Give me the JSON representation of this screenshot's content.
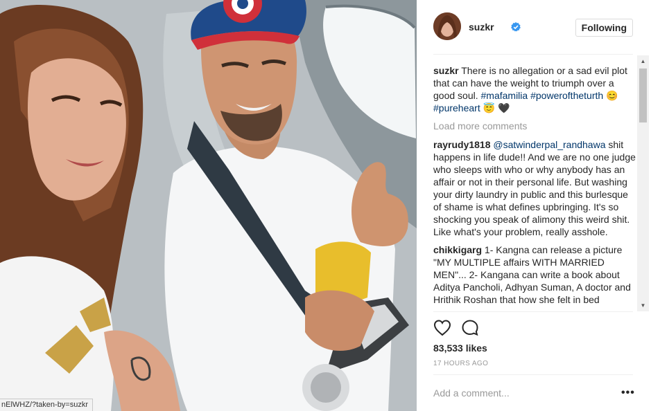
{
  "post": {
    "username": "suzkr",
    "follow_label": "Following",
    "caption": {
      "user": "suzkr",
      "text": "There is no allegation or a sad evil plot that can have the weight to triumph over a good soul.",
      "tag1": "#mafamilia",
      "tag2": "#poweroftheturth",
      "tag3": "#pureheart",
      "emoji1": "😊",
      "emoji2": "😇",
      "emoji3": "🖤"
    },
    "load_more": "Load more comments",
    "comments": [
      {
        "user": "rayrudy1818",
        "mention": "@satwinderpal_randhawa",
        "text": "shit happens in life dude!! And we are no one judge who sleeps with who or why anybody has an affair or not in their personal life. But washing your dirty laundry in public and this burlesque of shame is what defines upbringing. It's so shocking you speak of alimony this weird shit. Like what's your problem, really asshole."
      },
      {
        "user": "chikkigarg",
        "text": "1- Kangna can release a picture \"MY MULTIPLE affairs WITH MARRIED MEN\"... 2- Kangana can write a book about Aditya Pancholi, Adhyan Suman, A doctor and Hrithik Roshan that how she felt in bed"
      }
    ],
    "likes": "83,533 likes",
    "time": "17 HOURS AGO",
    "add_comment_placeholder": "Add a comment...",
    "more_label": "•••"
  },
  "browser": {
    "status_url": "nElWHZ/?taken-by=suzkr"
  },
  "icons": {
    "like": "heart-outline-icon",
    "comment": "comment-bubble-icon",
    "verified": "verified-badge-icon",
    "scroll_up": "scroll-up-arrow-icon",
    "scroll_down": "scroll-down-arrow-icon"
  },
  "colors": {
    "hashtag": "#003569",
    "verified": "#3897f0",
    "muted": "#999999",
    "text": "#262626"
  }
}
